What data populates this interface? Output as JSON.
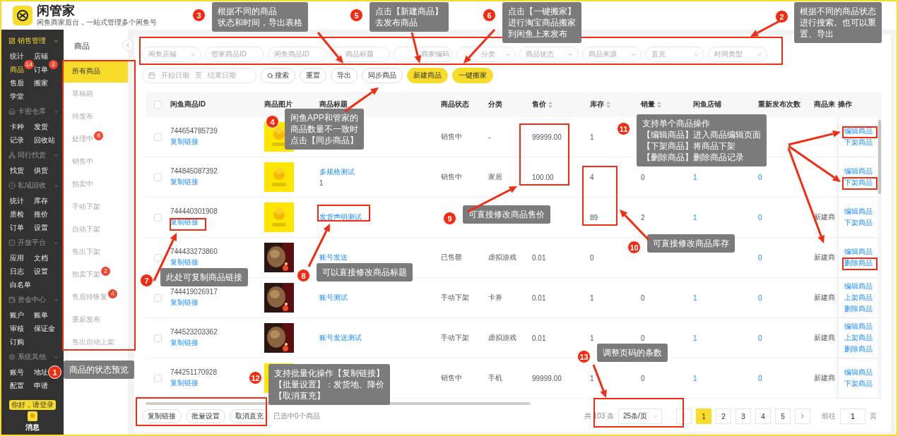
{
  "app": {
    "name": "闲管家",
    "tagline": "闲鱼商家后台，一站式管理多个闲鱼号"
  },
  "nav_groups": [
    {
      "title": "销售管理",
      "selected": true,
      "items": [
        {
          "label": "统计",
          "selected": false
        },
        {
          "label": "店铺",
          "selected": false
        },
        {
          "label": "商品",
          "selected": true,
          "badge": "14"
        },
        {
          "label": "订单",
          "selected": false,
          "badge": "2"
        },
        {
          "label": "售后",
          "selected": false
        },
        {
          "label": "搬家",
          "selected": false
        },
        {
          "label": "学堂",
          "selected": false
        }
      ]
    },
    {
      "title": "卡密仓库",
      "selected": false,
      "items": [
        {
          "label": "卡种",
          "selected": false
        },
        {
          "label": "发货",
          "selected": false
        },
        {
          "label": "记录",
          "selected": false
        },
        {
          "label": "回收站",
          "selected": false
        }
      ]
    },
    {
      "title": "同行找货",
      "selected": false,
      "items": [
        {
          "label": "找货",
          "selected": false
        },
        {
          "label": "供货",
          "selected": false
        }
      ]
    },
    {
      "title": "私域回收",
      "selected": false,
      "items": [
        {
          "label": "统计",
          "selected": false
        },
        {
          "label": "库存",
          "selected": false
        },
        {
          "label": "质检",
          "selected": false
        },
        {
          "label": "推价",
          "selected": false
        },
        {
          "label": "订单",
          "selected": false
        },
        {
          "label": "设置",
          "selected": false
        }
      ]
    },
    {
      "title": "开放平台",
      "selected": false,
      "items": [
        {
          "label": "应用",
          "selected": false
        },
        {
          "label": "文档",
          "selected": false
        },
        {
          "label": "日志",
          "selected": false
        },
        {
          "label": "设置",
          "selected": false
        },
        {
          "label": "白名单",
          "selected": false
        }
      ]
    },
    {
      "title": "资金中心",
      "selected": false,
      "items": [
        {
          "label": "账户",
          "selected": false
        },
        {
          "label": "账单",
          "selected": false
        },
        {
          "label": "审核",
          "selected": false
        },
        {
          "label": "保证金",
          "selected": false
        },
        {
          "label": "订购",
          "selected": false
        }
      ]
    },
    {
      "title": "系统其他",
      "selected": false,
      "items": [
        {
          "label": "账号",
          "selected": false
        },
        {
          "label": "地址",
          "selected": false
        },
        {
          "label": "配置",
          "selected": false
        },
        {
          "label": "申请",
          "selected": false
        }
      ]
    }
  ],
  "login_tip": "你好，请登录",
  "messages_label": "消息",
  "subnav": {
    "title": "商品",
    "items": [
      {
        "label": "所有商品",
        "selected": true
      },
      {
        "label": "草稿箱",
        "selected": false
      },
      {
        "label": "待发布",
        "selected": false
      },
      {
        "label": "处理中",
        "selected": false,
        "badge": "8"
      },
      {
        "label": "销售中",
        "selected": false
      },
      {
        "label": "拍卖中",
        "selected": false
      },
      {
        "label": "手动下架",
        "selected": false
      },
      {
        "label": "自动下架",
        "selected": false
      },
      {
        "label": "售出下架",
        "selected": false
      },
      {
        "label": "拍卖下架",
        "selected": false,
        "badge": "2"
      },
      {
        "label": "售后待恢复",
        "selected": false,
        "badge": "4"
      },
      {
        "label": "重新发布",
        "selected": false
      },
      {
        "label": "售出自动上架",
        "selected": false
      }
    ]
  },
  "filters": [
    {
      "kind": "select",
      "placeholder": "闲鱼店铺"
    },
    {
      "kind": "input",
      "placeholder": "管家商品ID"
    },
    {
      "kind": "input",
      "placeholder": "闲鱼商品ID"
    },
    {
      "kind": "input",
      "placeholder": "商品标题"
    },
    {
      "kind": "input",
      "placeholder": "商家编码"
    },
    {
      "kind": "select",
      "placeholder": "分类"
    },
    {
      "kind": "select",
      "placeholder": "商品状态"
    },
    {
      "kind": "select",
      "placeholder": "商品来源"
    },
    {
      "kind": "select",
      "placeholder": "直充"
    },
    {
      "kind": "select",
      "placeholder": "时间类型"
    }
  ],
  "date_range": {
    "start_placeholder": "开始日期",
    "separator": "至",
    "end_placeholder": "结束日期"
  },
  "actions": [
    {
      "label": "搜索",
      "kind": "search"
    },
    {
      "label": "重置",
      "kind": "plain"
    },
    {
      "label": "导出",
      "kind": "plain"
    },
    {
      "label": "同步商品",
      "kind": "plain"
    },
    {
      "label": "新建商品",
      "kind": "primary"
    },
    {
      "label": "一键搬家",
      "kind": "primary"
    }
  ],
  "table": {
    "header_checked": false,
    "columns": [
      {
        "label": "闲鱼商品ID",
        "sortable": false
      },
      {
        "label": "商品图片",
        "sortable": false
      },
      {
        "label": "商品标题",
        "sortable": false
      },
      {
        "label": "商品状态",
        "sortable": false
      },
      {
        "label": "分类",
        "sortable": false
      },
      {
        "label": "售价",
        "sortable": true
      },
      {
        "label": "库存",
        "sortable": true
      },
      {
        "label": "销量",
        "sortable": true
      },
      {
        "label": "闲鱼店铺",
        "sortable": false
      },
      {
        "label": "重新发布次数",
        "sortable": false
      },
      {
        "label": "商品来",
        "sortable": false
      },
      {
        "label": "操作",
        "sortable": false
      }
    ],
    "rows": [
      {
        "checked": false,
        "id": "744654785739",
        "copy_link": "复制链接",
        "status": "销售中",
        "category": "-",
        "price": "99999.00",
        "stock": "1",
        "operations": [
          "编辑商品",
          "下架商品"
        ]
      },
      {
        "checked": false,
        "id": "744845087392",
        "copy_link": "复制链接",
        "title": "多规格测试",
        "subtitle": "1",
        "status": "销售中",
        "category": "家居",
        "price": "100.00",
        "stock": "4",
        "sales": "0",
        "shop": "1",
        "republish": "0",
        "operations": [
          "编辑商品",
          "下架商品"
        ]
      },
      {
        "checked": false,
        "id": "744440301908",
        "copy_link": "复制链接",
        "title": "发货声明测试",
        "stock": "89",
        "sales": "2",
        "shop": "1",
        "republish": "0",
        "source": "新建商",
        "operations": [
          "编辑商品",
          "下架商品"
        ]
      },
      {
        "checked": false,
        "id": "744433273860",
        "copy_link": "复制链接",
        "title": "账号发送",
        "status": "已售罄",
        "category": "虚拟游戏",
        "price": "0.01",
        "stock": "0",
        "republish": "0",
        "source": "新建商",
        "operations": [
          "编辑商品",
          "删除商品"
        ]
      },
      {
        "checked": false,
        "id": "744419026917",
        "copy_link": "复制链接",
        "title": "账号测试",
        "status": "手动下架",
        "category": "卡券",
        "price": "0.01",
        "stock": "1",
        "sales": "0",
        "shop": "1",
        "republish": "0",
        "source": "新建商",
        "operations": [
          "编辑商品",
          "上架商品",
          "删除商品"
        ]
      },
      {
        "checked": false,
        "id": "744523203362",
        "copy_link": "复制链接",
        "title": "账号发送测试",
        "status": "手动下架",
        "category": "虚拟游戏",
        "price": "0.01",
        "stock": "1",
        "sales": "0",
        "shop": "1",
        "republish": "0",
        "source": "新建商",
        "operations": [
          "编辑商品",
          "上架商品",
          "删除商品"
        ]
      },
      {
        "checked": false,
        "id": "744251170928",
        "copy_link": "复制链接",
        "status": "销售中",
        "category": "手机",
        "price": "99999.00",
        "stock": "1",
        "sales": "0",
        "shop": "1",
        "republish": "0",
        "source": "新建商",
        "operations": [
          "编辑商品",
          "下架商品"
        ]
      }
    ]
  },
  "footer": {
    "bulk_actions": [
      "复制链接",
      "批量设置",
      "取消直充"
    ],
    "selection_text": "已选中0个商品",
    "total": "共 103 条",
    "page_size": "25条/页",
    "pages": [
      {
        "label": "1",
        "selected": true
      },
      {
        "label": "2",
        "selected": false
      },
      {
        "label": "3",
        "selected": false
      },
      {
        "label": "4",
        "selected": false
      },
      {
        "label": "5",
        "selected": false
      }
    ],
    "goto_label": "前往",
    "goto_value": "1",
    "page_suffix": "页"
  },
  "annotations": [
    {
      "number": "3",
      "lines": [
        "根据不同的商品",
        "状态和时间，导出表格"
      ]
    },
    {
      "number": "5",
      "lines": [
        "点击【新建商品】",
        "去发布商品"
      ]
    },
    {
      "number": "6",
      "lines": [
        "点击【一键搬家】",
        "进行淘宝商品搬家",
        "到闲鱼上来发布"
      ]
    },
    {
      "number": "2",
      "lines": [
        "根据不同的商品状态",
        "进行搜索。也可以重",
        "置、导出"
      ]
    },
    {
      "number": "4",
      "lines": [
        "闲鱼APP和管家的",
        "商品数量不一致时",
        "点击【同步商品】"
      ]
    },
    {
      "number": "11",
      "lines": [
        "支持单个商品操作",
        "【编辑商品】进入商品编辑页面",
        "【下架商品】将商品下架",
        "【删除商品】删除商品记录"
      ]
    },
    {
      "number": "9",
      "lines": [
        "可直接修改商品售价"
      ]
    },
    {
      "number": "10",
      "lines": [
        "可直接修改商品库存"
      ]
    },
    {
      "number": "8",
      "lines": [
        "可以直接修改商品标题"
      ]
    },
    {
      "number": "7",
      "lines": [
        "此处可复制商品链接"
      ]
    },
    {
      "number": "13",
      "lines": [
        "调整页码的条数"
      ]
    },
    {
      "number": "1",
      "lines": [
        "商品的状态预览"
      ]
    },
    {
      "number": "12",
      "lines": [
        "支持批量化操作【复制链接】",
        "【批量设置】：发货地、降价",
        "【取消直充】"
      ]
    }
  ]
}
